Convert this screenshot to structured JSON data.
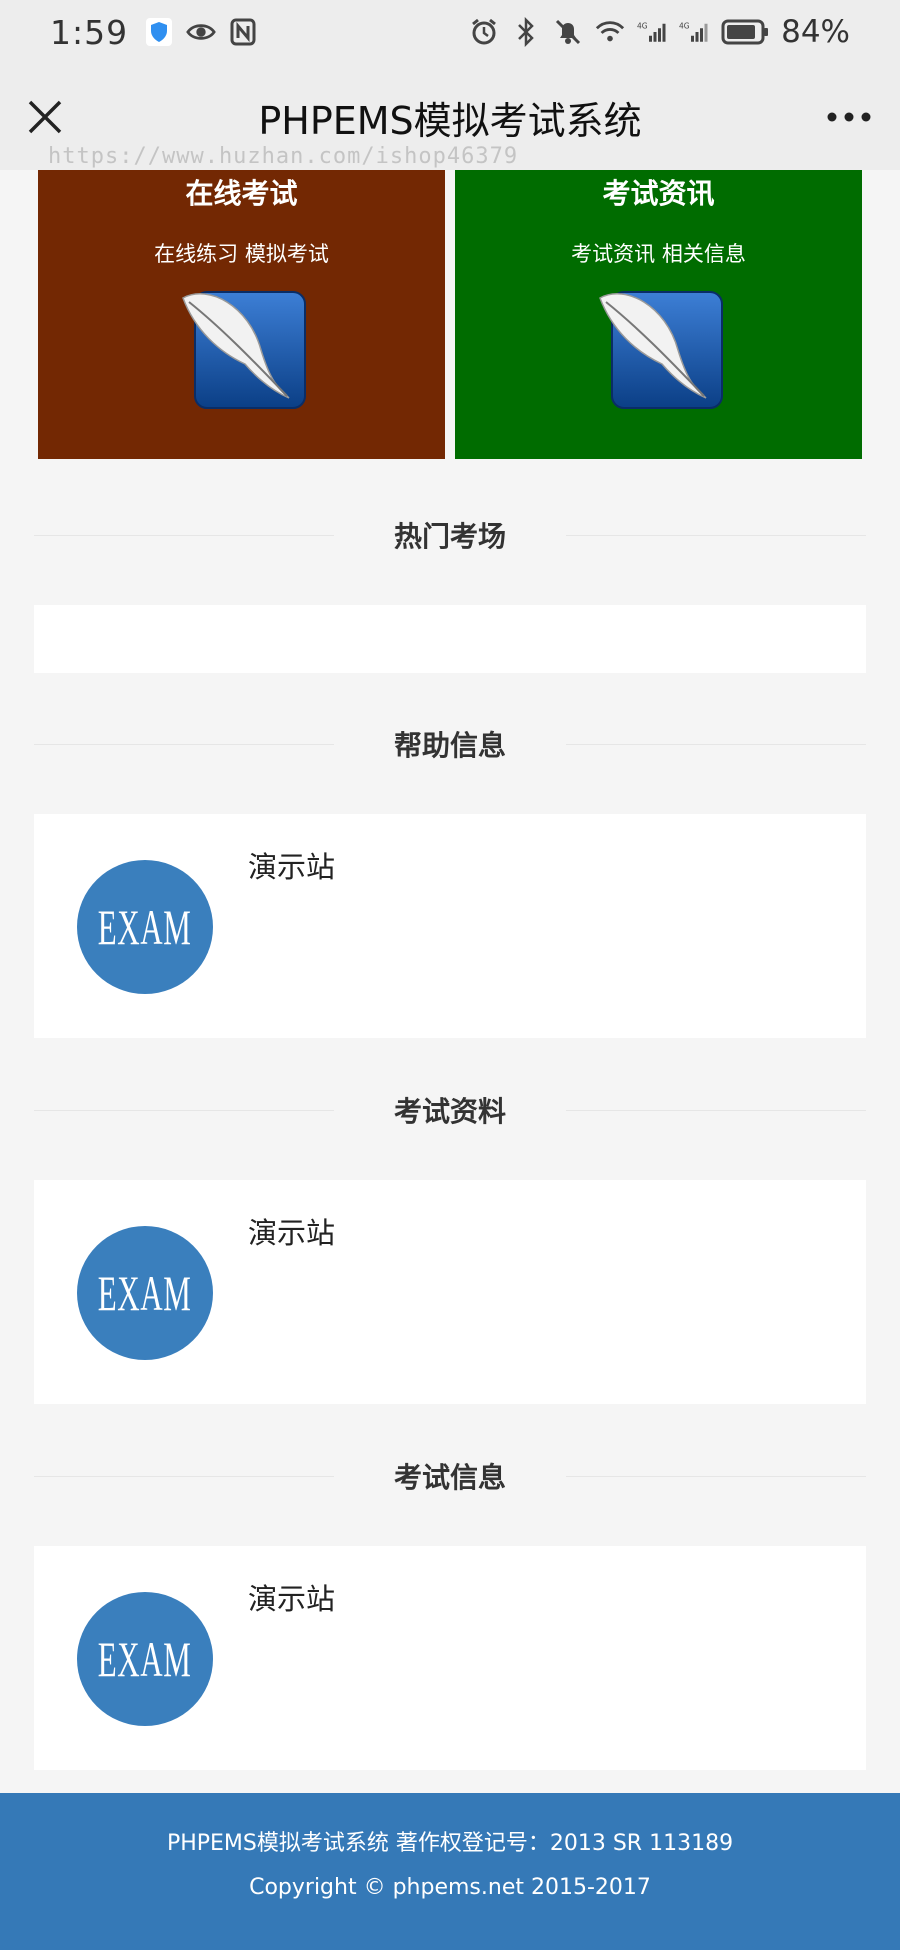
{
  "status_bar": {
    "time": "1:59",
    "battery": "84%",
    "network_1": "4G",
    "network_2": "4G"
  },
  "header": {
    "title": "PHPEMS模拟考试系统",
    "watermark": "https://www.huzhan.com/ishop46379"
  },
  "tiles": [
    {
      "title": "在线考试",
      "subtitle": "在线练习 模拟考试",
      "color": "#732803"
    },
    {
      "title": "考试资讯",
      "subtitle": "考试资讯 相关信息",
      "color": "#006c00"
    }
  ],
  "sections": {
    "hot": {
      "heading": "热门考场"
    },
    "help": {
      "heading": "帮助信息",
      "item_title": "演示站",
      "logo_text": "EXAM"
    },
    "materials": {
      "heading": "考试资料",
      "item_title": "演示站",
      "logo_text": "EXAM"
    },
    "info": {
      "heading": "考试信息",
      "item_title": "演示站",
      "logo_text": "EXAM"
    }
  },
  "footer": {
    "line1": "PHPEMS模拟考试系统 著作权登记号：2013 SR 113189",
    "line2": "Copyright © phpems.net 2015-2017"
  },
  "colors": {
    "accent": "#3579b7",
    "tile_brown": "#732803",
    "tile_green": "#006c00"
  }
}
